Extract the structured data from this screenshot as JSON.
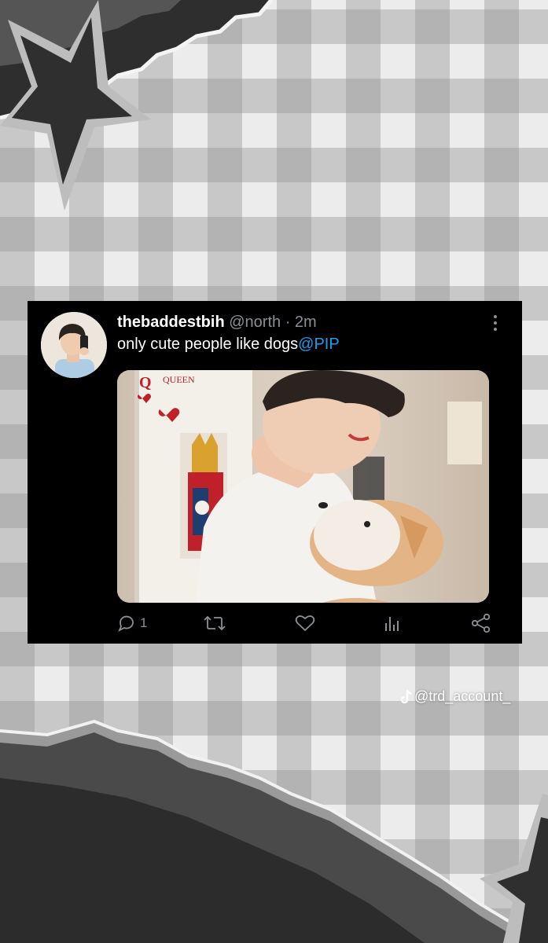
{
  "tweet": {
    "name": "thebaddestbih",
    "handle": "@north",
    "separator": "·",
    "time": "2m",
    "text": "only cute people like dogs",
    "mention": "@PIP",
    "reply_count": "1",
    "media": {
      "card_letter": "Q",
      "card_text": "QUEEN"
    }
  },
  "icons": {
    "more": "more-vertical-icon",
    "reply": "comment-icon",
    "retweet": "retweet-icon",
    "like": "heart-icon",
    "analytics": "analytics-icon",
    "share": "share-icon",
    "tiktok": "tiktok-icon"
  },
  "watermark": {
    "text": "@trd_account_"
  },
  "colors": {
    "tweet_bg": "#000000",
    "text": "#ffffff",
    "muted": "#8b8f94",
    "link": "#1d9bf0",
    "plaid_light": "#ececec",
    "plaid_dark": "#a8a8a8"
  }
}
